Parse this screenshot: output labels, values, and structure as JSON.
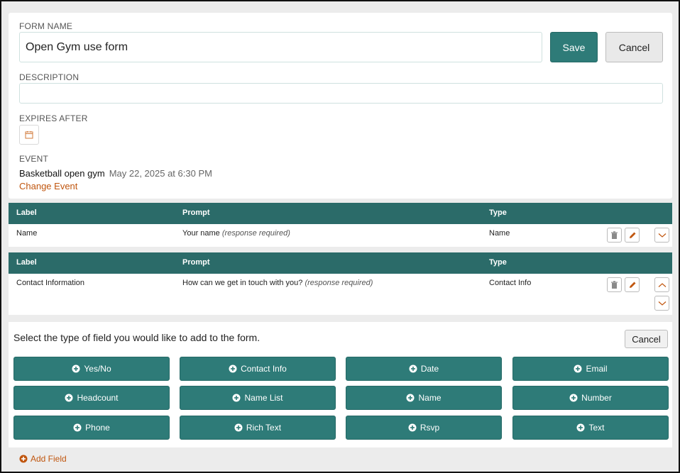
{
  "form": {
    "name_label": "FORM NAME",
    "name_value": "Open Gym use form",
    "save_label": "Save",
    "cancel_label": "Cancel",
    "description_label": "DESCRIPTION",
    "description_value": "",
    "expires_label": "EXPIRES AFTER",
    "event_label": "EVENT",
    "event_name": "Basketball open gym",
    "event_date": "May 22, 2025 at 6:30 PM",
    "change_event_label": "Change Event"
  },
  "fields_table": {
    "headers": {
      "label": "Label",
      "prompt": "Prompt",
      "type": "Type"
    },
    "rows": [
      {
        "label": "Name",
        "prompt": "Your name",
        "required": "(response required)",
        "type": "Name"
      },
      {
        "label": "Contact Information",
        "prompt": "How can we get in touch with you?",
        "required": "(response required)",
        "type": "Contact Info"
      }
    ]
  },
  "adder": {
    "prompt": "Select the type of field you would like to add to the form.",
    "cancel_label": "Cancel",
    "types": [
      "Yes/No",
      "Contact Info",
      "Date",
      "Email",
      "Headcount",
      "Name List",
      "Name",
      "Number",
      "Phone",
      "Rich Text",
      "Rsvp",
      "Text"
    ]
  },
  "add_field_label": "Add Field",
  "colors": {
    "accent": "#2e7b78",
    "header": "#2b6b69",
    "link": "#c0560f"
  },
  "icons": [
    "calendar-icon",
    "trash-icon",
    "pencil-icon",
    "chevron-up-icon",
    "chevron-down-icon",
    "plus-circle-icon"
  ]
}
